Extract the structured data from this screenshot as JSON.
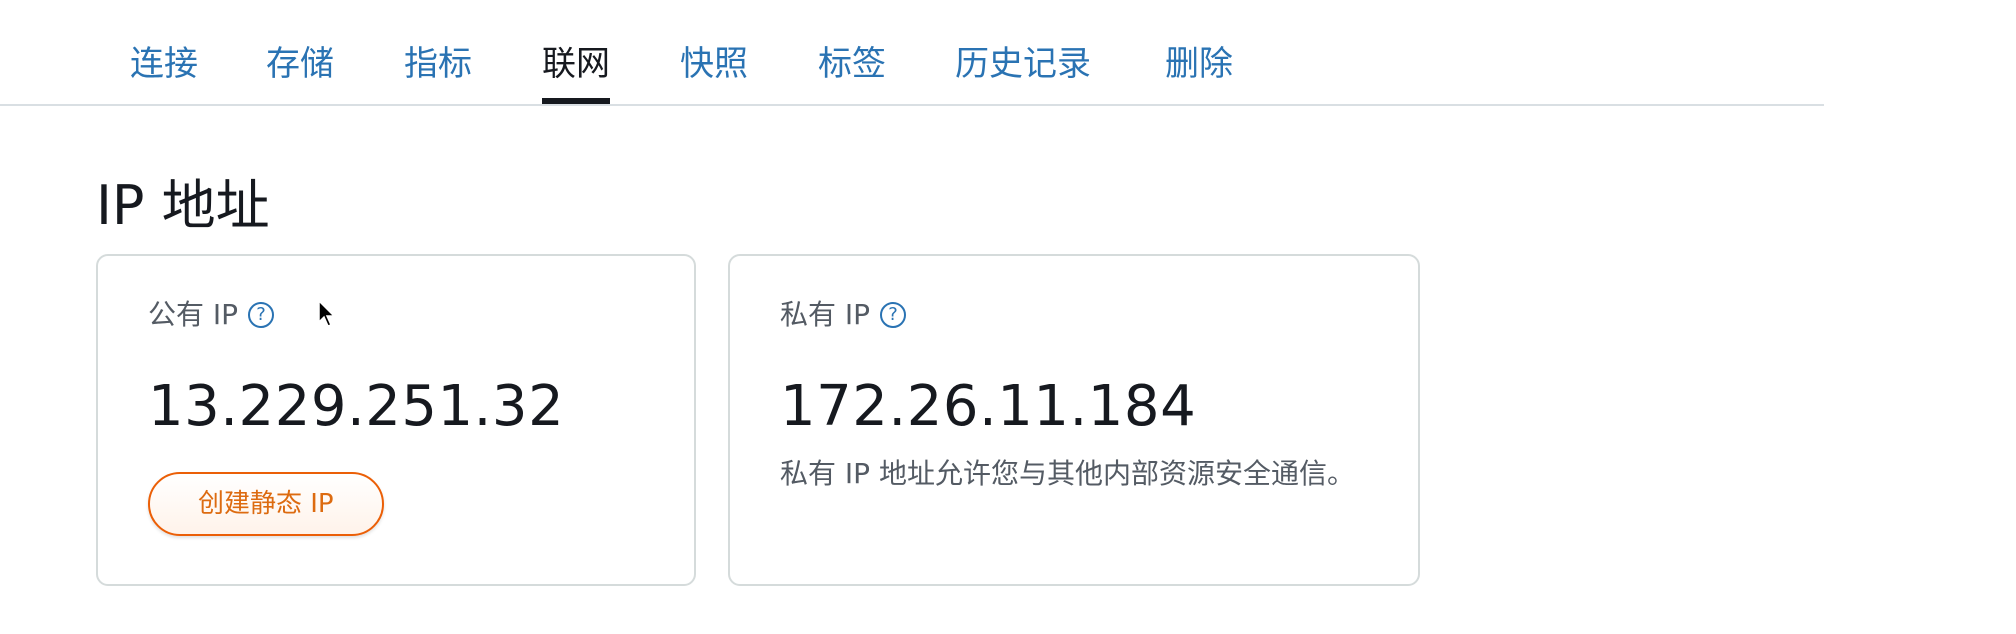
{
  "tabs": [
    {
      "label": "连接",
      "active": false
    },
    {
      "label": "存储",
      "active": false
    },
    {
      "label": "指标",
      "active": false
    },
    {
      "label": "联网",
      "active": true
    },
    {
      "label": "快照",
      "active": false
    },
    {
      "label": "标签",
      "active": false
    },
    {
      "label": "历史记录",
      "active": false
    },
    {
      "label": "删除",
      "active": false
    }
  ],
  "section": {
    "title": "IP 地址"
  },
  "public_ip": {
    "label": "公有 IP",
    "help_icon": "question-circle-icon",
    "value": "13.229.251.32",
    "button_label": "创建静态 IP"
  },
  "private_ip": {
    "label": "私有 IP",
    "help_icon": "question-circle-icon",
    "value": "172.26.11.184",
    "description": "私有 IP 地址允许您与其他内部资源安全通信。"
  },
  "colors": {
    "link": "#2a73b3",
    "text": "#16191f",
    "muted": "#545b64",
    "accent_orange": "#eb5f07",
    "border": "#d5dbdb"
  }
}
